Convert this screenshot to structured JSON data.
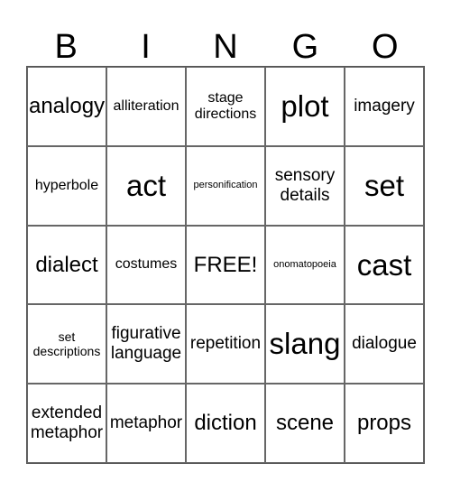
{
  "header": {
    "letters": [
      "B",
      "I",
      "N",
      "G",
      "O"
    ]
  },
  "board": {
    "rows": [
      [
        "analogy",
        "alliteration",
        "stage\ndirections",
        "plot",
        "imagery"
      ],
      [
        "hyperbole",
        "act",
        "personification",
        "sensory\ndetails",
        "set"
      ],
      [
        "dialect",
        "costumes",
        "FREE!",
        "onomatopoeia",
        "cast"
      ],
      [
        "set\ndescriptions",
        "figurative\nlanguage",
        "repetition",
        "slang",
        "dialogue"
      ],
      [
        "extended\nmetaphor",
        "metaphor",
        "diction",
        "scene",
        "props"
      ]
    ],
    "free_space": "FREE!"
  }
}
